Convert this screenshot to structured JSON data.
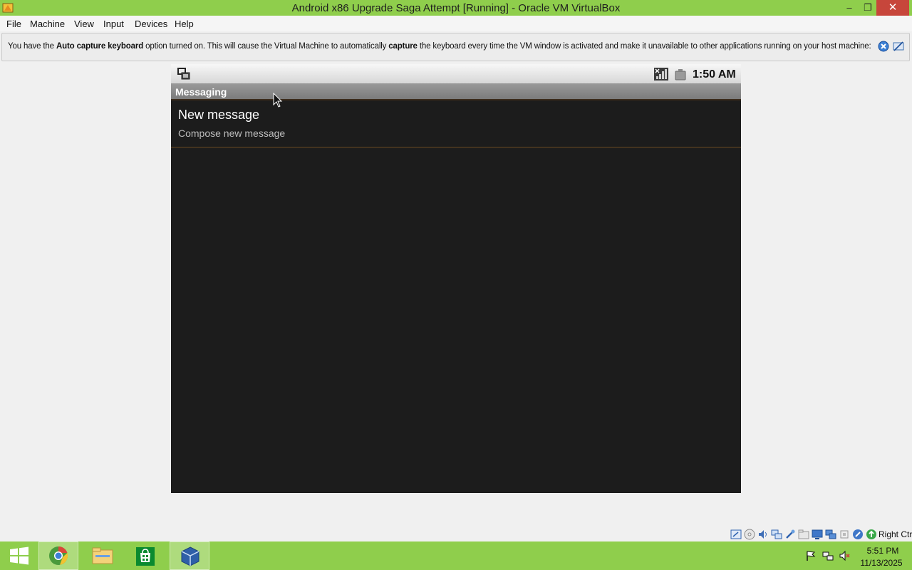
{
  "window": {
    "title": "Android x86 Upgrade Saga Attempt [Running] - Oracle VM VirtualBox",
    "minimize_glyph": "–",
    "maximize_glyph": "❐",
    "close_glyph": "✕"
  },
  "menu": {
    "items": [
      {
        "label": "File"
      },
      {
        "label": "Machine"
      },
      {
        "label": "View"
      },
      {
        "label": "Input"
      },
      {
        "label": "Devices"
      },
      {
        "label": "Help"
      }
    ]
  },
  "banner": {
    "part1": "You have the ",
    "bold1": "Auto capture keyboard",
    "part2": " option turned on. This will cause the Virtual Machine to automatically ",
    "bold2": "capture",
    "part3": " the keyboard every time the VM window is activated and make it unavailable to other applications running on your host machine:",
    "icons": [
      "info-close-icon",
      "dont-show-again-icon"
    ]
  },
  "android": {
    "status_time": "1:50 AM",
    "app_title": "Messaging",
    "items": [
      {
        "title": "New message",
        "subtitle": "Compose new message"
      }
    ]
  },
  "vm_status": {
    "host_key": "Right Ctrl",
    "icons": [
      "hard-disk-icon",
      "optical-drive-icon",
      "audio-icon",
      "network-icon",
      "usb-icon",
      "shared-folders-icon",
      "display-icon",
      "video-capture-icon",
      "cpu-icon",
      "mouse-integration-icon",
      "keyboard-capture-icon"
    ]
  },
  "taskbar": {
    "apps": [
      "start-button",
      "chrome-icon",
      "file-explorer-icon",
      "store-icon",
      "virtualbox-icon"
    ],
    "time": "5:51 PM",
    "date": "11/13/2025"
  },
  "colors": {
    "accent_green": "#8fce4c",
    "android_bg": "#1c1c1c",
    "close_red": "#c7463b"
  }
}
